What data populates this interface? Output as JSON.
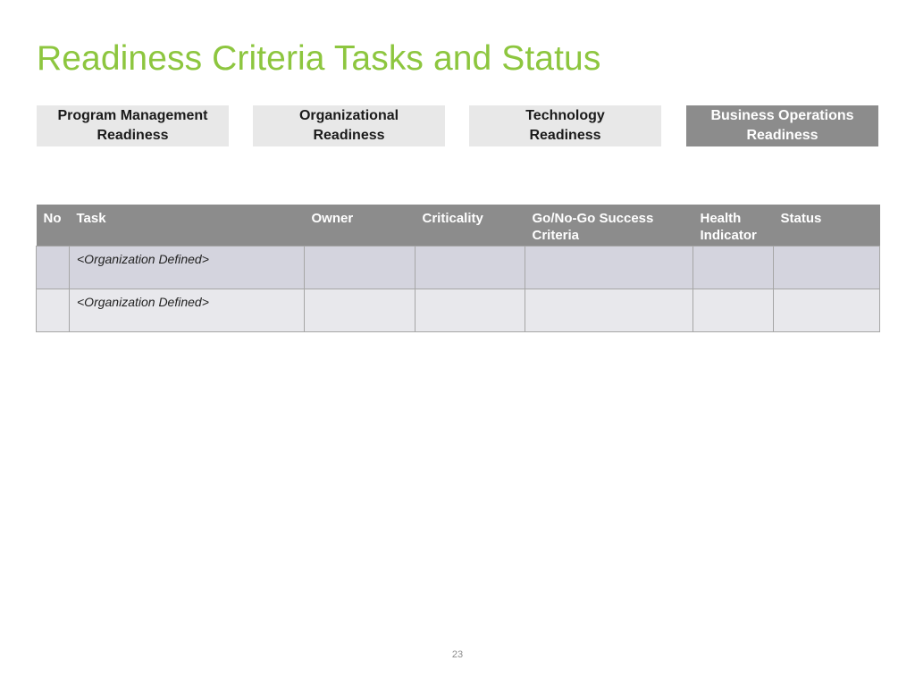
{
  "page": {
    "title": "Readiness Criteria Tasks and Status",
    "page_number": "23"
  },
  "tabs": [
    {
      "line1": "Program Management",
      "line2": "Readiness",
      "active": false
    },
    {
      "line1": "Organizational",
      "line2": "Readiness",
      "active": false
    },
    {
      "line1": "Technology",
      "line2": "Readiness",
      "active": false
    },
    {
      "line1": "Business Operations",
      "line2": "Readiness",
      "active": true
    }
  ],
  "table": {
    "headers": {
      "no": "No",
      "task": "Task",
      "owner": "Owner",
      "criticality": "Criticality",
      "criteria_line1": "Go/No-Go Success",
      "criteria_line2": "Criteria",
      "health_line1": "Health",
      "health_line2": "Indicator",
      "status": "Status"
    },
    "rows": [
      {
        "no": "",
        "task": "<Organization Defined>",
        "owner": "",
        "criticality": "",
        "criteria": "",
        "health": "",
        "status": ""
      },
      {
        "no": "",
        "task": "<Organization Defined>",
        "owner": "",
        "criticality": "",
        "criteria": "",
        "health": "",
        "status": ""
      }
    ]
  },
  "colors": {
    "title": "#8dc63f",
    "header_bg": "#8c8c8c",
    "tab_bg": "#e8e8e8",
    "tab_active_bg": "#8c8c8c",
    "row_odd": "#d4d4de",
    "row_even": "#e8e8ec"
  }
}
